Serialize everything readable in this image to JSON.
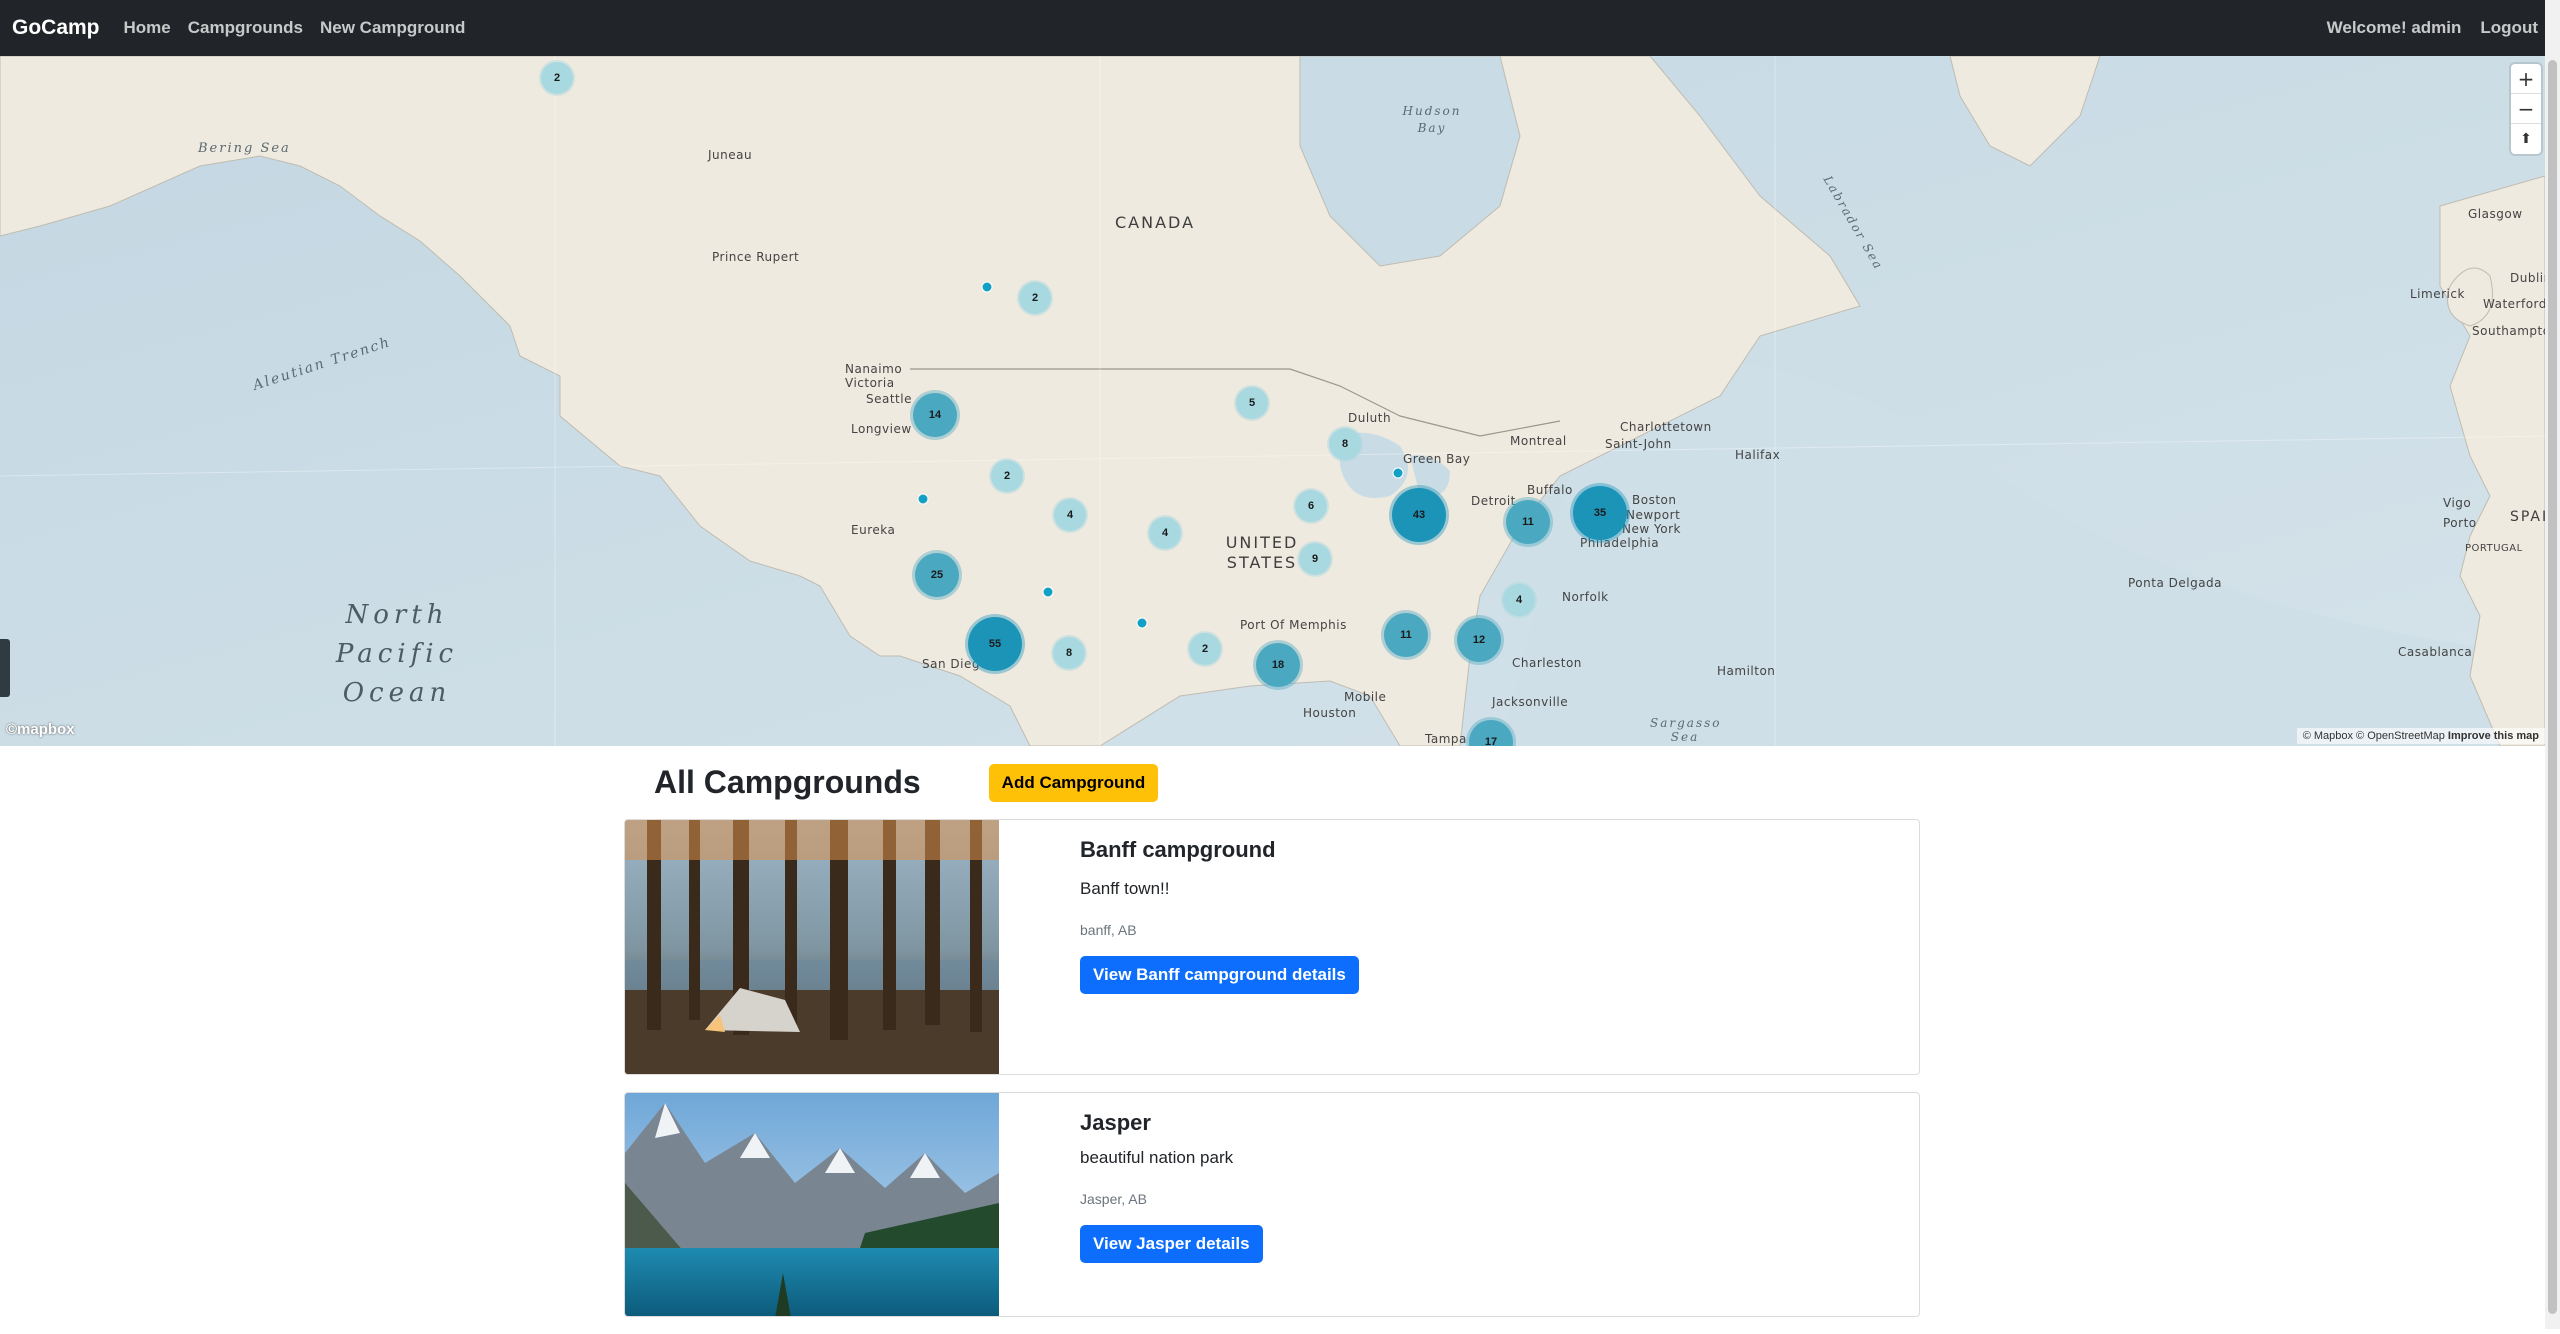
{
  "nav": {
    "brand": "GoCamp",
    "links": [
      "Home",
      "Campgrounds",
      "New Campground"
    ],
    "welcome": "Welcome! admin",
    "logout": "Logout"
  },
  "map": {
    "oceans": [
      "Bering Sea",
      "Aleutian Trench",
      "North Pacific Ocean",
      "Hudson Bay",
      "Labrador Sea",
      "Sargasso Sea"
    ],
    "countries": [
      "CANADA",
      "UNITED STATES",
      "SPAIN",
      "PORTUGAL"
    ],
    "cities": [
      "Juneau",
      "Prince Rupert",
      "Nanaimo",
      "Victoria",
      "Seattle",
      "Longview",
      "Eureka",
      "San Diego",
      "Port Of Memphis",
      "Houston",
      "Mobile",
      "Tampa",
      "Jacksonville",
      "Charleston",
      "Norfolk",
      "Philadelphia",
      "New York",
      "Newport",
      "Boston",
      "Buffalo",
      "Detroit",
      "Green Bay",
      "Duluth",
      "Montreal",
      "Saint-John",
      "Charlottetown",
      "Halifax",
      "Hamilton",
      "Ponta Delgada",
      "Casablanca",
      "Vigo",
      "Porto",
      "Limerick",
      "Waterford",
      "Glasgow",
      "Dublin",
      "Southampton"
    ],
    "clusters": [
      "2",
      "2",
      "14",
      "2",
      "4",
      "4",
      "25",
      "55",
      "8",
      "2",
      "18",
      "11",
      "12",
      "4",
      "43",
      "11",
      "35",
      "5",
      "8",
      "6",
      "9",
      "17"
    ],
    "zoom_in": "+",
    "zoom_out": "−",
    "compass": "⬆",
    "logo": "©mapbox",
    "attribution": "© Mapbox © OpenStreetMap",
    "improve": "Improve this map"
  },
  "page": {
    "title": "All Campgrounds",
    "add_button": "Add Campground"
  },
  "campgrounds": [
    {
      "title": "Banff campground",
      "description": "Banff town!!",
      "location": "banff, AB",
      "button": "View Banff campground details"
    },
    {
      "title": "Jasper",
      "description": "beautiful nation park",
      "location": "Jasper, AB",
      "button": "View Jasper details"
    }
  ]
}
